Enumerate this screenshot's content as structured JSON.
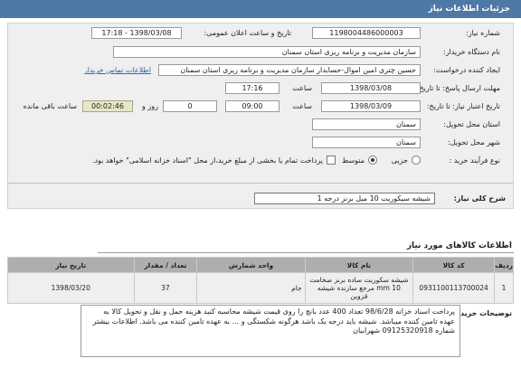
{
  "header": {
    "title": "جزئیات اطلاعات نیاز"
  },
  "form": {
    "need_number_label": "شماره نیاز:",
    "need_number": "1198004486000003",
    "announce_label": "تاریخ و ساعت اعلان عمومی:",
    "announce_value": "1398/03/08 - 17:18",
    "buyer_org_label": "نام دستگاه خریدار:",
    "buyer_org": "سازمان مدیریت و برنامه ریزی استان سمنان",
    "creator_label": "ایجاد کننده درخواست:",
    "creator": "حسین چتری امین اموال-حسابدار سازمان مدیریت و برنامه ریزی استان سمنان",
    "buyer_contact_link": "اطلاعات تماس خریدار",
    "send_deadline_label": "مهلت ارسال پاسخ: تا تاریخ:",
    "send_deadline_date": "1398/03/08",
    "time_label": "ساعت",
    "send_deadline_time": "17:16",
    "validity_label": "تاریخ اعتبار نیاز: تا تاریخ:",
    "validity_date": "1398/03/09",
    "validity_time": "09:00",
    "days_value": "0",
    "days_label": "روز و",
    "remaining_time": "00:02:46",
    "remaining_label": "ساعت باقی مانده",
    "delivery_province_label": "استان محل تحویل:",
    "delivery_province": "سمنان",
    "delivery_city_label": "شهر محل تحویل:",
    "delivery_city": "سمنان",
    "purchase_type_label": "نوع فرآیند خرید :",
    "purchase_options": [
      "جزیی",
      "متوسط"
    ],
    "purchase_selected": "متوسط",
    "payment_note": "پرداخت تمام یا بخشی از مبلغ خرید،از محل \"اسناد خزانه اسلامی\" خواهد بود."
  },
  "summary": {
    "label": "شرح کلی نیاز:",
    "value": "شیشه سیکوریت 10 میل برنز درجه 1"
  },
  "goods": {
    "title": "اطلاعات کالاهای مورد نیاز",
    "columns": [
      "ردیف",
      "کد کالا",
      "نام کالا",
      "واحد شمارش",
      "تعداد / مقدار",
      "تاریخ نیاز"
    ],
    "rows": [
      {
        "row": "1",
        "code": "0931100113700024",
        "name": "شیشه سکوریت ساده برنز ضخامت 10 mm مرجع سازنده شیشه قزوین",
        "unit": "جام",
        "qty": "37",
        "date": "1398/03/20"
      }
    ]
  },
  "buyer_notes": {
    "label": "توضیحات خریدار:",
    "text": "پرداخت اسناد خزانه 98/6/28 تعداد 400 عدد بانچ را روی قیمت شیشه محاسبه کنید هزینه حمل و نقل و تحویل کالا به عهده تامین کننده میباشد. شیشه باید درجه یک باشد هرگونه شکستگی و ... به عهده تامین کننده می باشد. اطلاعات بیشتر شماره 09125320918 شهرابیان"
  }
}
